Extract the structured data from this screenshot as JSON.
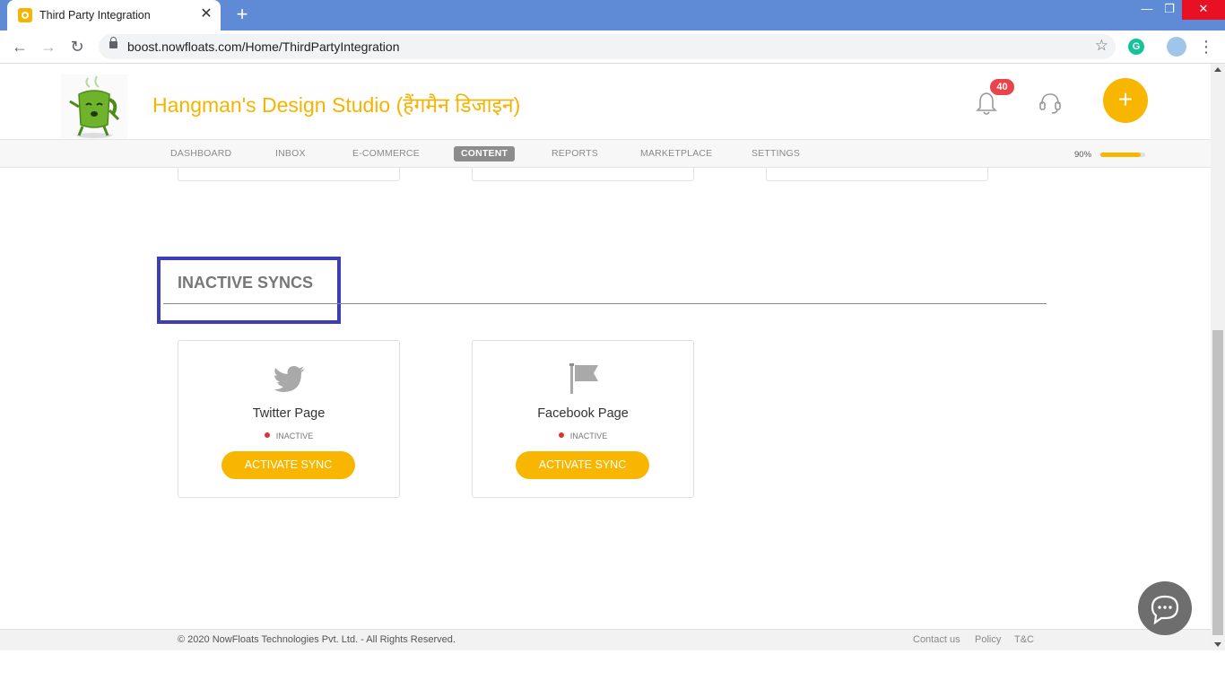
{
  "browser": {
    "tab_title": "Third Party Integration",
    "close_glyph": "✕",
    "new_tab_glyph": "+",
    "url": "boost.nowfloats.com/Home/ThirdPartyIntegration",
    "star_glyph": "☆",
    "back_glyph": "←",
    "forward_glyph": "→",
    "reload_glyph": "↻",
    "ext_label": "G",
    "menu_glyph": "⋮",
    "min_glyph": "—",
    "max_glyph": "❐",
    "winclose_glyph": "✕"
  },
  "header": {
    "brand": "Hangman's Design Studio (हैंगमैन डिजाइन)",
    "notification_count": "40",
    "add_glyph": "+"
  },
  "nav": {
    "items": [
      {
        "label": "DASHBOARD",
        "active": false
      },
      {
        "label": "INBOX",
        "active": false
      },
      {
        "label": "E-COMMERCE",
        "active": false
      },
      {
        "label": "CONTENT",
        "active": true
      },
      {
        "label": "REPORTS",
        "active": false
      },
      {
        "label": "MARKETPLACE",
        "active": false
      },
      {
        "label": "SETTINGS",
        "active": false
      }
    ],
    "progress_label": "90%",
    "progress_value": 0.9
  },
  "section": {
    "title": "INACTIVE SYNCS"
  },
  "cards": [
    {
      "title": "Twitter Page",
      "status": "INACTIVE",
      "button": "ACTIVATE SYNC",
      "icon": "twitter-icon"
    },
    {
      "title": "Facebook Page",
      "status": "INACTIVE",
      "button": "ACTIVATE SYNC",
      "icon": "flag-icon"
    }
  ],
  "footer": {
    "copyright": "© 2020 NowFloats Technologies Pvt. Ltd. - All Rights Reserved.",
    "links": [
      "Contact us",
      "Policy",
      "T&C"
    ]
  },
  "colors": {
    "accent": "#f8b600",
    "tabbar": "#5f8ad6",
    "highlight": "#3d3db5",
    "badge": "#e9444b"
  }
}
